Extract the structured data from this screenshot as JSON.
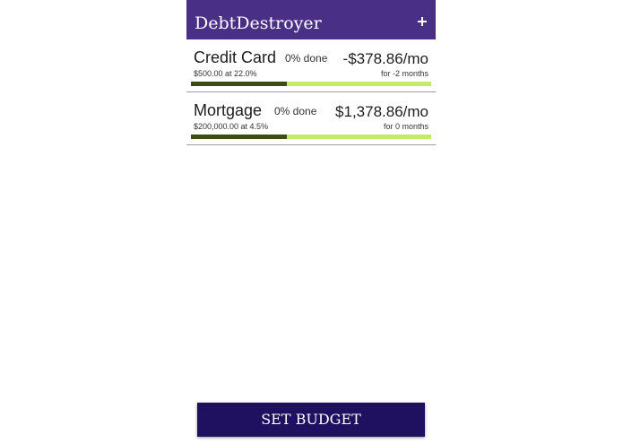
{
  "app_bar": {
    "title": "DebtDestroyer",
    "add_icon": "plus-icon"
  },
  "debts": [
    {
      "name": "Credit Card",
      "detail": "$500.00 at 22.0%",
      "progress_text": "0% done",
      "payment": "-$378.86/mo",
      "term": "for -2 months",
      "progress_fraction": 0.4
    },
    {
      "name": "Mortgage",
      "detail": "$200,000.00 at 4.5%",
      "progress_text": "0% done",
      "payment": "$1,378.86/mo",
      "term": "for 0 months",
      "progress_fraction": 0.4
    }
  ],
  "footer": {
    "set_budget_label": "SET BUDGET"
  },
  "colors": {
    "app_bar": "#4a2f87",
    "progress_track": "#c2ec66",
    "progress_fill": "#3c4d14",
    "button": "#201060"
  }
}
